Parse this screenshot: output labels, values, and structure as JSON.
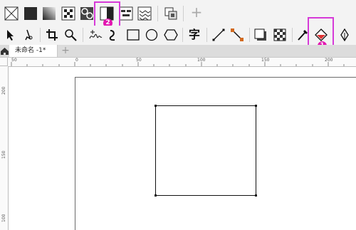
{
  "fill_toolbar": {
    "icons": [
      "no-fill-icon",
      "uniform-fill-icon",
      "fountain-fill-icon",
      "vector-pattern-fill-icon",
      "bitmap-pattern-fill-icon",
      "two-color-pattern-fill-icon",
      "texture-fill-icon",
      "postscript-fill-icon",
      "color-styles-icon"
    ],
    "add_label": "+"
  },
  "tools": [
    "pick-tool-icon",
    "shape-tool-icon",
    "crop-tool-icon",
    "zoom-tool-icon",
    "freehand-tool-icon",
    "artistic-media-icon",
    "rectangle-tool-icon",
    "ellipse-tool-icon",
    "polygon-tool-icon",
    "text-tool-icon",
    "dimension-tool-icon",
    "connector-tool-icon",
    "drop-shadow-tool-icon",
    "transparency-tool-icon",
    "color-eyedropper-icon",
    "interactive-fill-tool-icon",
    "smart-fill-icon"
  ],
  "text_tool_label": "字",
  "document_tab": {
    "title": "未命名 -1*",
    "add_label": "+"
  },
  "annotations": {
    "badge_1": "1",
    "badge_2": "2"
  },
  "ruler": {
    "horizontal": [
      "50",
      "0",
      "50",
      "100",
      "150",
      "200"
    ],
    "vertical": [
      "200",
      "150",
      "100"
    ]
  },
  "colors": {
    "highlight": "#d63ad8",
    "badge": "#e316b1"
  }
}
